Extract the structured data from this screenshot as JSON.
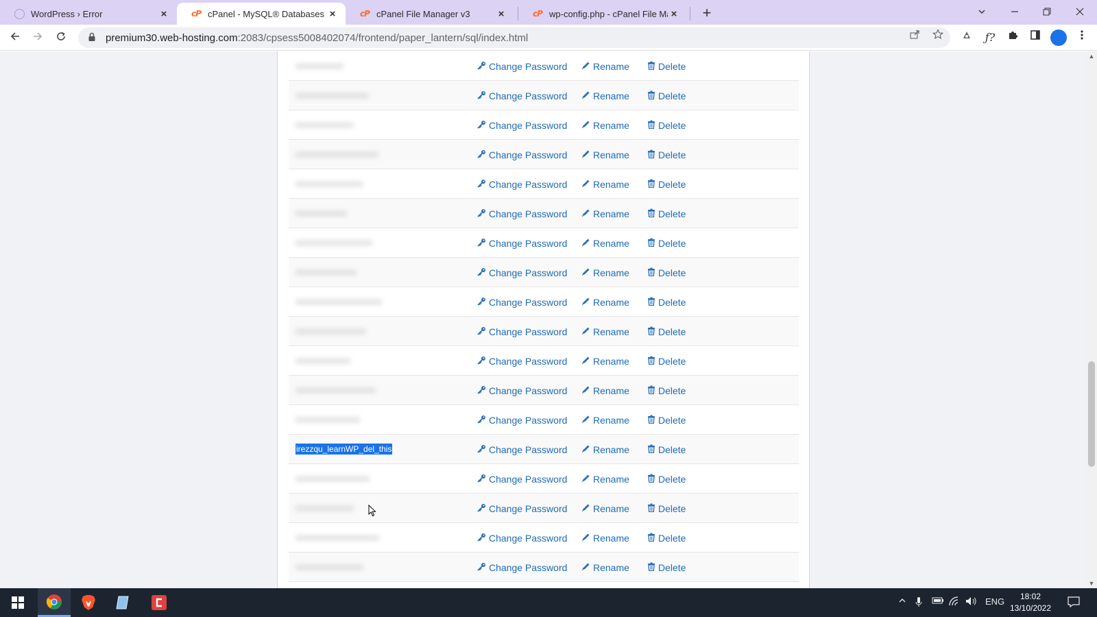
{
  "tabs": [
    {
      "title": "WordPress › Error",
      "favicon": "wordpress-loading-icon",
      "active": false
    },
    {
      "title": "cPanel - MySQL® Databases",
      "favicon": "cpanel-logo-icon",
      "active": true
    },
    {
      "title": "cPanel File Manager v3",
      "favicon": "cpanel-logo-icon",
      "active": false
    },
    {
      "title": "wp-config.php - cPanel File Mana",
      "favicon": "cpanel-logo-icon",
      "active": false
    }
  ],
  "favicon_label": "cP",
  "address_bar": {
    "host": "premium30.web-hosting.com",
    "path": ":2083/cpsess5008402074/frontend/paper_lantern/sql/index.html"
  },
  "actions": {
    "change_password": "Change Password",
    "rename": "Rename",
    "delete": "Delete"
  },
  "users": [
    {
      "name": "",
      "highlighted": false
    },
    {
      "name": "",
      "highlighted": false
    },
    {
      "name": "",
      "highlighted": false
    },
    {
      "name": "",
      "highlighted": false
    },
    {
      "name": "",
      "highlighted": false
    },
    {
      "name": "",
      "highlighted": false
    },
    {
      "name": "",
      "highlighted": false
    },
    {
      "name": "",
      "highlighted": false
    },
    {
      "name": "",
      "highlighted": false
    },
    {
      "name": "",
      "highlighted": false
    },
    {
      "name": "",
      "highlighted": false
    },
    {
      "name": "",
      "highlighted": false
    },
    {
      "name": "",
      "highlighted": false
    },
    {
      "name": "irezzqu_learnWP_del_this",
      "highlighted": true
    },
    {
      "name": "",
      "highlighted": false
    },
    {
      "name": "",
      "highlighted": false
    },
    {
      "name": "",
      "highlighted": false
    },
    {
      "name": "",
      "highlighted": false
    }
  ],
  "taskbar": {
    "language": "ENG",
    "time": "18:02",
    "date": "13/10/2022"
  },
  "colors": {
    "link": "#1f6bb3",
    "selection": "#1a73e8",
    "tabstrip": "#dcd2f4"
  }
}
